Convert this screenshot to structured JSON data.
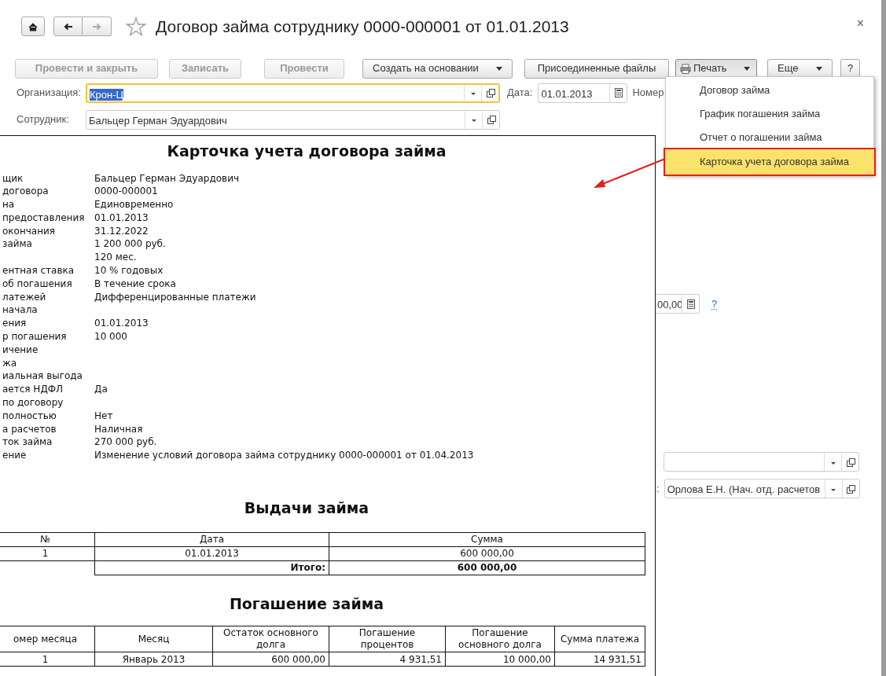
{
  "window": {
    "title": "Договор займа сотруднику 0000-000001 от 01.01.2013",
    "close": "×",
    "favorite": false
  },
  "nav_buttons": [
    {
      "kind": "home",
      "disabled": false
    },
    {
      "kind": "back",
      "disabled": false
    },
    {
      "kind": "forward",
      "disabled": true
    }
  ],
  "toolbar": [
    {
      "label": "Провести и закрыть",
      "kind": "plain",
      "disabled": true,
      "dropdown": false,
      "pressed": false
    },
    {
      "label": "Записать",
      "kind": "plain",
      "disabled": true,
      "dropdown": false,
      "pressed": false
    },
    {
      "label": "Провести",
      "kind": "plain",
      "disabled": true,
      "dropdown": false,
      "pressed": false
    },
    {
      "label": "Создать на основании",
      "kind": "plain",
      "disabled": false,
      "dropdown": true,
      "pressed": false
    },
    {
      "label": "Присоединенные файлы",
      "kind": "plain",
      "disabled": false,
      "dropdown": false,
      "pressed": false
    },
    {
      "label": "Печать",
      "kind": "print",
      "disabled": false,
      "dropdown": true,
      "pressed": true
    },
    {
      "label": "Еще",
      "kind": "plain",
      "disabled": false,
      "dropdown": true,
      "pressed": false
    },
    {
      "label": "?",
      "kind": "help",
      "disabled": false,
      "dropdown": false,
      "pressed": false
    }
  ],
  "form": {
    "organization": {
      "label": "Организация:",
      "value": "Крон-Ц",
      "focused": true
    },
    "date": {
      "label": "Дата:",
      "value": "01.01.2013"
    },
    "number": {
      "label": "Номер"
    },
    "employee": {
      "label": "Сотрудник:",
      "value": "Бальцер Герман Эдуардович"
    },
    "amount": {
      "value": "00,00",
      "help": "?"
    },
    "responsible": {
      "label": ":",
      "value": "Орлова Е.Н. (Нач. отд. расчетов"
    }
  },
  "print_menu": [
    {
      "label": "Договор займа",
      "selected": false
    },
    {
      "label": "График погашения займа",
      "selected": false
    },
    {
      "label": "Отчет о погашении займа",
      "selected": false
    },
    {
      "label": "Карточка учета договора займа",
      "selected": true
    }
  ],
  "report": {
    "title": "Карточка учета договора займа",
    "details": [
      {
        "label": "щик",
        "value": "Бальцер Герман Эдуардович"
      },
      {
        "label": "договора",
        "value": "0000-000001"
      },
      {
        "label": "на",
        "value": "Единовременно"
      },
      {
        "label": "предоставления",
        "value": "01.01.2013"
      },
      {
        "label": "окончания",
        "value": "31.12.2022"
      },
      {
        "label": "займа",
        "value": "1 200 000 руб."
      },
      {
        "value": "120 мес."
      },
      {
        "label": "ентная ставка",
        "value": "10 % годовых"
      },
      {
        "label": "об погашения",
        "value": "В течение срока"
      },
      {
        "label": "латежей",
        "value": "Дифференцированные платежи"
      },
      {
        "label": "начала"
      },
      {
        "label": "ения",
        "value": "01.01.2013"
      },
      {
        "label": "р погашения",
        "value": "10 000"
      },
      {
        "label": "ичение"
      },
      {
        "label": "жа"
      },
      {
        "label": "иальная выгода"
      },
      {
        "label": "ается НДФЛ",
        "value": "Да"
      },
      {
        "label": "по договору"
      },
      {
        "label": "полностью",
        "value": "Нет"
      },
      {
        "label": "а расчетов",
        "value": "Наличная"
      },
      {
        "label": "ток займа",
        "value": "270 000 руб."
      },
      {
        "label": "ение",
        "value": "Изменение условий договора займа сотруднику 0000-000001 от 01.04.2013"
      }
    ],
    "issues": {
      "title": "Выдачи займа",
      "columns": [
        "№",
        "Дата",
        "Сумма"
      ],
      "rows": [
        [
          "1",
          "01.01.2013",
          "600 000,00"
        ]
      ],
      "total_label": "Итого:",
      "total_value": "600 000,00"
    },
    "repayment": {
      "title": "Погашение займа",
      "columns": [
        "омер месяца",
        "Месяц",
        "Остаток основного долга",
        "Погашение процентов",
        "Погашение основного долга",
        "Сумма платежа"
      ],
      "rows": [
        [
          "1",
          "Январь 2013",
          "600 000,00",
          "4 931,51",
          "10 000,00",
          "14 931,51"
        ]
      ]
    }
  }
}
